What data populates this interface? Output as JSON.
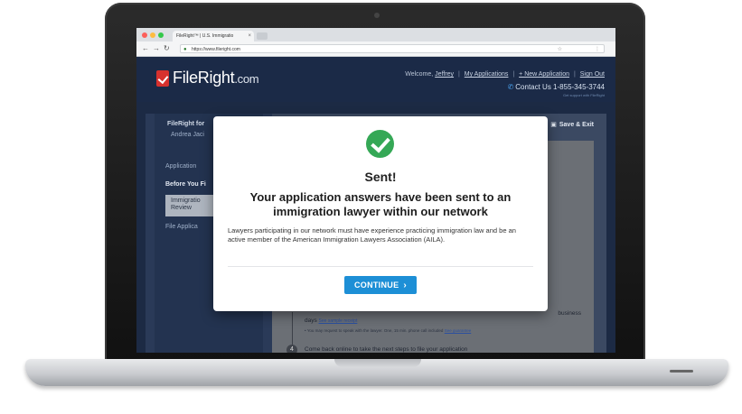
{
  "browser": {
    "tab_title": "FileRight™ | U.S. Immigratio",
    "url": "https://www.fileright.com"
  },
  "header": {
    "logo_main": "FileRight",
    "logo_suffix": ".com",
    "welcome_prefix": "Welcome,",
    "user_name": "Jeffrey",
    "links": [
      "My Applications",
      "+ New Application",
      "Sign Out"
    ],
    "contact": "Contact Us 1-855-345-3744",
    "contact_sub": "Get support with FileRight"
  },
  "sidebar": {
    "title": "FileRight for",
    "name": "Andrea Jaci",
    "section_application": "Application",
    "before_you": "Before You Fi",
    "review_box_line1": "Immigratio",
    "review_box_line2": "Review",
    "file_application": "File Applica"
  },
  "main": {
    "save_exit": "Save & Exit",
    "step_line_a": "days",
    "step_link_a": "See sample receipt",
    "step_line_a_end": "business",
    "step_bullet": "You may request to speak with the lawyer. One, 15 min. phone call included",
    "step_bullet_link": "See guarantee",
    "step_number": "4",
    "step_line_b": "Come back online to take the next steps to file your application"
  },
  "modal": {
    "title": "Sent!",
    "heading": "Your application answers have been sent to an immigration lawyer within our network",
    "body": "Lawyers participating in our network must have experience practicing immigration law and be an active member of the American Immigration Lawyers Association (AILA).",
    "button_label": "CONTINUE"
  },
  "colors": {
    "accent": "#1d8fd6",
    "success": "#35a856",
    "header_bg": "#1b2a47",
    "brand_red": "#d7312e"
  },
  "icons": [
    "check-circle-icon",
    "chevron-right-icon",
    "phone-icon",
    "lock-icon",
    "save-icon"
  ]
}
